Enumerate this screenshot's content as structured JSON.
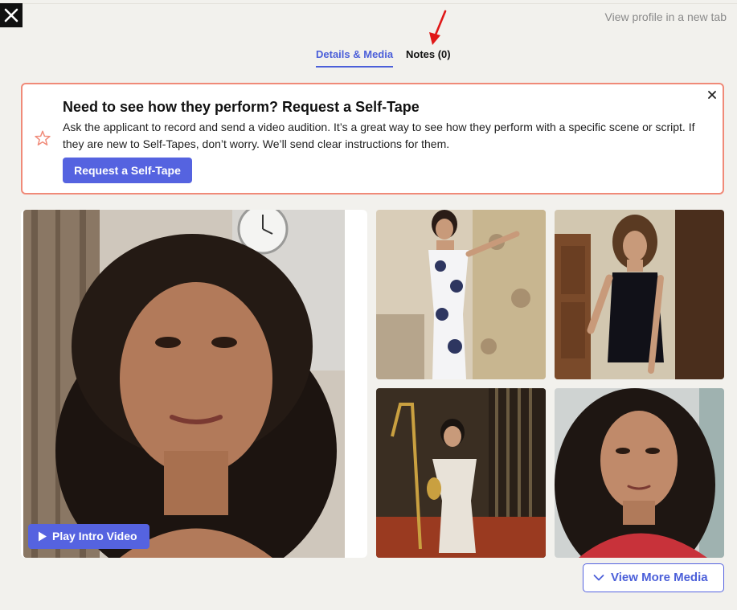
{
  "header": {
    "view_profile_link": "View profile in a new tab"
  },
  "tabs": [
    {
      "label": "Details & Media",
      "active": true
    },
    {
      "label": "Notes (0)",
      "active": false
    }
  ],
  "banner": {
    "title": "Need to see how they perform? Request a Self-Tape",
    "body": "Ask the applicant to record and send a video audition. It’s a great way to see how they perform with a specific scene or script. If they are new to Self-Tapes, don’t worry. We’ll send clear instructions for them.",
    "button_label": "Request a Self-Tape",
    "icon": "star-icon"
  },
  "media": {
    "play_button_label": "Play Intro Video",
    "view_more_label": "View More Media",
    "photo_count": 5
  },
  "colors": {
    "accent": "#5563e0",
    "banner_border": "#f08a78",
    "background": "#f2f1ed",
    "annotation_arrow": "#e01818"
  }
}
